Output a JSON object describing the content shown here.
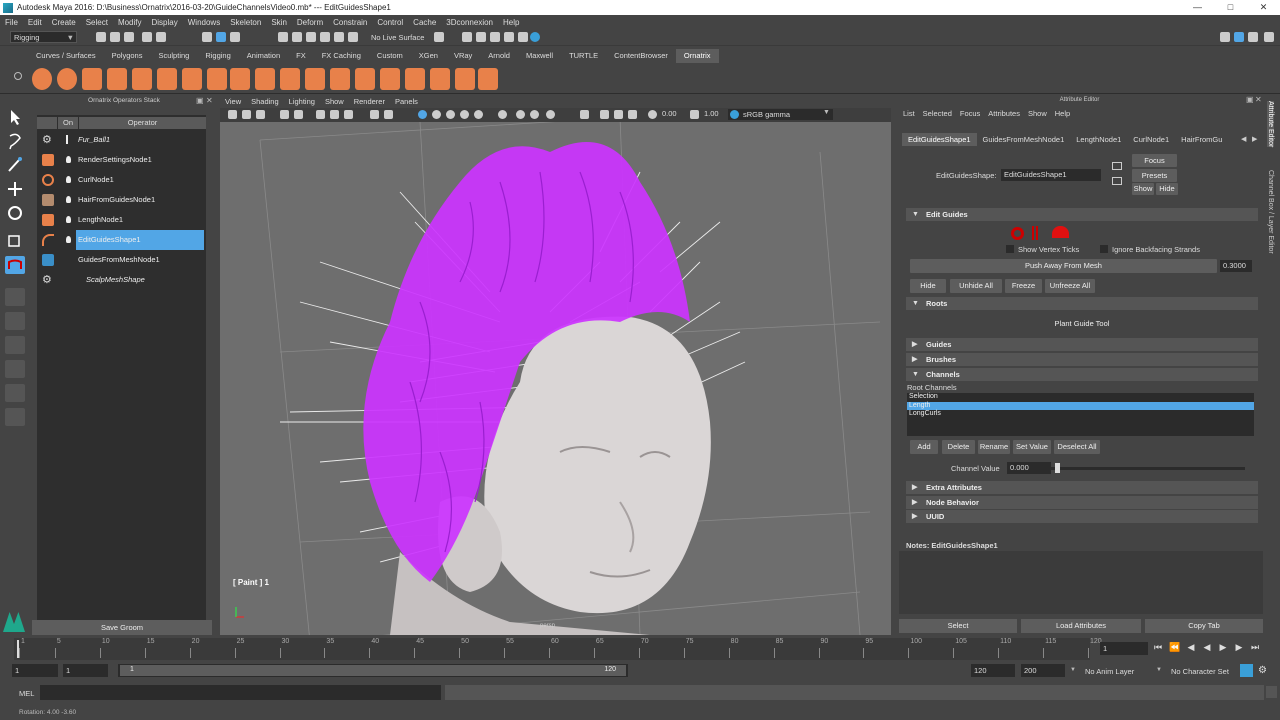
{
  "window": {
    "title": "Autodesk Maya 2016: D:\\Business\\Ornatrix\\2016-03-20\\GuideChannelsVideo0.mb* --- EditGuidesShape1"
  },
  "menubar": [
    "File",
    "Edit",
    "Create",
    "Select",
    "Modify",
    "Display",
    "Windows",
    "Skeleton",
    "Skin",
    "Deform",
    "Constrain",
    "Control",
    "Cache",
    "3Dconnexion",
    "Help"
  ],
  "statusline": {
    "mode": "Rigging",
    "surface": "No Live Surface"
  },
  "shelf_tabs": [
    "Curves / Surfaces",
    "Polygons",
    "Sculpting",
    "Rigging",
    "Animation",
    "FX",
    "FX Caching",
    "Custom",
    "XGen",
    "VRay",
    "Arnold",
    "Maxwell",
    "TURTLE",
    "ContentBrowser",
    "Ornatrix"
  ],
  "shelf_active": "Ornatrix",
  "operator_stack": {
    "title": "Ornatrix Operators Stack",
    "col_on": "On",
    "col_operator": "Operator",
    "rows": [
      "Fur_Ball1",
      "RenderSettingsNode1",
      "CurlNode1",
      "HairFromGuidesNode1",
      "LengthNode1",
      "EditGuidesShape1",
      "GuidesFromMeshNode1",
      "ScalpMeshShape"
    ],
    "save_button": "Save Groom"
  },
  "viewport": {
    "menu": [
      "View",
      "Shading",
      "Lighting",
      "Show",
      "Renderer",
      "Panels"
    ],
    "field_a": "0.00",
    "field_b": "1.00",
    "color_space": "sRGB gamma",
    "paint_label": "[ Paint ] 1",
    "camera": "persp"
  },
  "attribute_editor": {
    "title": "Attribute Editor",
    "menu": [
      "List",
      "Selected",
      "Focus",
      "Attributes",
      "Show",
      "Help"
    ],
    "tabs": [
      "EditGuidesShape1",
      "GuidesFromMeshNode1",
      "LengthNode1",
      "CurlNode1",
      "HairFromGu"
    ],
    "node_label": "EditGuidesShape:",
    "node_value": "EditGuidesShape1",
    "focus": "Focus",
    "presets": "Presets",
    "show": "Show",
    "hide": "Hide",
    "edit_guides": "Edit Guides",
    "show_vertex_ticks": "Show Vertex Ticks",
    "ignore_backfacing": "Ignore Backfacing Strands",
    "push_away": "Push Away From Mesh",
    "push_value": "0.3000",
    "btn_hide": "Hide",
    "btn_unhide_all": "Unhide All",
    "btn_freeze": "Freeze",
    "btn_unfreeze_all": "Unfreeze All",
    "roots": "Roots",
    "plant_guide_tool": "Plant Guide Tool",
    "guides": "Guides",
    "brushes": "Brushes",
    "channels": "Channels",
    "root_channels": "Root Channels",
    "channel_list": [
      "Selection",
      "Length",
      "LongCurls"
    ],
    "selected_channel": "Length",
    "btn_add": "Add",
    "btn_delete": "Delete",
    "btn_rename": "Rename",
    "btn_set_value": "Set Value",
    "btn_deselect_all": "Deselect All",
    "channel_value_label": "Channel Value",
    "channel_value": "0.000",
    "extra_attributes": "Extra Attributes",
    "node_behavior": "Node Behavior",
    "uuid": "UUID",
    "notes": "Notes:  EditGuidesShape1",
    "bottom_select": "Select",
    "bottom_load": "Load Attributes",
    "bottom_copy": "Copy Tab"
  },
  "right_strip": {
    "label_a": "Attribute Editor",
    "label_b": "Channel Box / Layer Editor"
  },
  "timeline": {
    "ticks": [
      "1",
      "5",
      "10",
      "15",
      "20",
      "25",
      "30",
      "35",
      "40",
      "45",
      "50",
      "55",
      "60",
      "65",
      "70",
      "75",
      "80",
      "85",
      "90",
      "95",
      "100",
      "105",
      "110",
      "115",
      "120"
    ],
    "current": "1"
  },
  "range": {
    "start": "1",
    "playback_start": "1",
    "slider_start": "1",
    "slider_end": "120",
    "playback_end": "120",
    "end": "200",
    "anim_layer": "No Anim Layer",
    "char_set": "No Character Set"
  },
  "cmdline": {
    "lang": "MEL"
  },
  "helpline": {
    "text": "Rotation:    4.00     -3.60"
  },
  "colors": {
    "accent": "#52a6e6",
    "hair": "#cc33ff",
    "shelf_icon": "#e8814a"
  }
}
